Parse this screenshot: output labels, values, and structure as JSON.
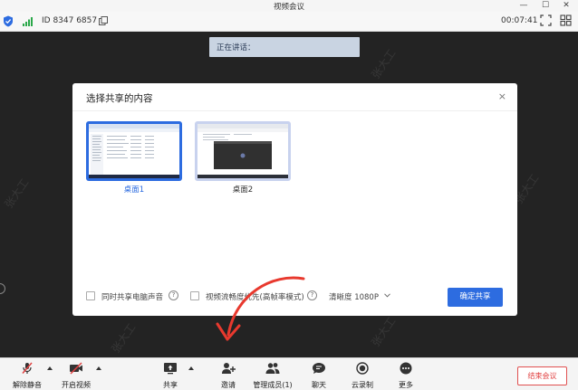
{
  "window": {
    "title": "视频会议"
  },
  "infobar": {
    "meeting_id": "ID 8347 6857",
    "timer": "00:07:41"
  },
  "speaking": {
    "label": "正在讲话："
  },
  "watermark": "张大工",
  "dialog": {
    "title": "选择共享的内容",
    "close": "×",
    "items": [
      {
        "label": "桌面1",
        "selected": true
      },
      {
        "label": "桌面2",
        "selected": false
      }
    ],
    "options": {
      "share_audio": "同时共享电脑声音",
      "video_priority": "视频流畅度优先(高帧率模式)",
      "clarity": "清晰度 1080P",
      "help": "?"
    },
    "confirm": "确定共享"
  },
  "toolbar": {
    "unmute": "解除静音",
    "start_video": "开启视频",
    "share": "共享",
    "invite": "邀请",
    "members": "管理成员(1)",
    "chat": "聊天",
    "record": "云录制",
    "more": "更多",
    "end": "结束会议"
  },
  "colors": {
    "accent": "#2d6ce0",
    "danger": "#e04040",
    "background": "#232323"
  }
}
